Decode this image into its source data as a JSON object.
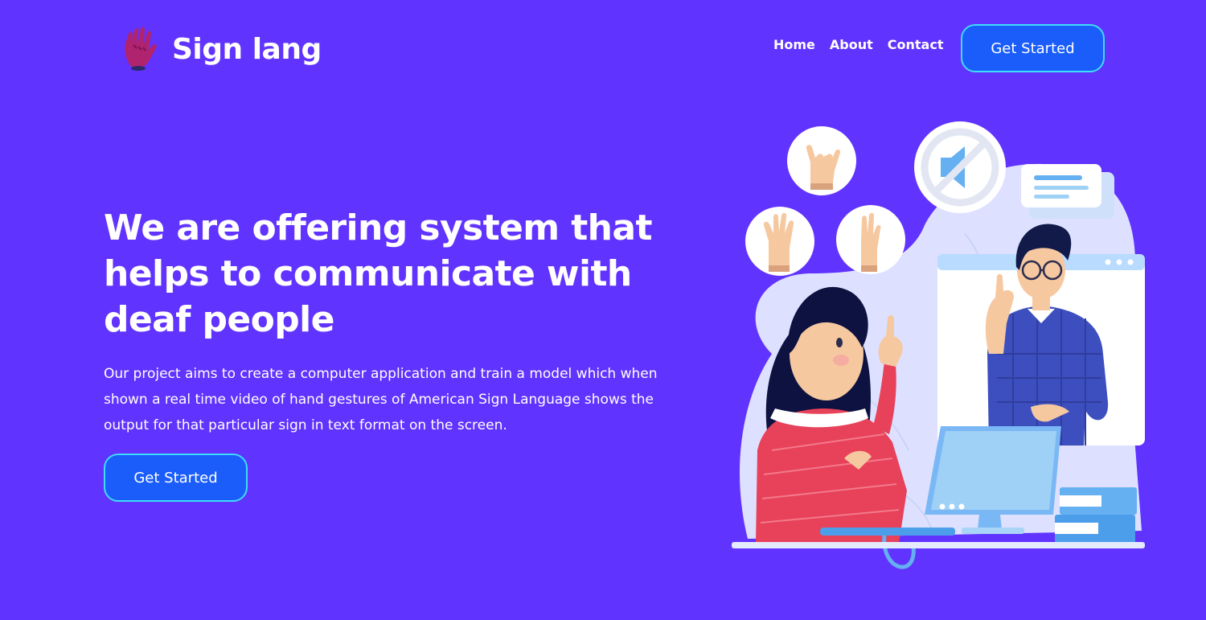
{
  "brand": {
    "name": "Sign lang",
    "logo_icon": "raised-hand-icon"
  },
  "nav": {
    "links": [
      "Home",
      "About",
      "Contact"
    ],
    "cta_label": "Get Started"
  },
  "hero": {
    "title": "We are offering system that helps to communicate with deaf people",
    "description": "Our project aims to create a computer application and train a model which when shown a real time video of hand gestures of American Sign Language shows the output for that particular sign in text format on the screen.",
    "cta_label": "Get Started"
  },
  "illustration": {
    "subject": "sign-language-video-call-illustration",
    "icons": [
      "hand-sign-icon",
      "hand-sign-icon",
      "hand-sign-icon",
      "muted-speaker-icon",
      "chat-bubble-icon"
    ]
  },
  "colors": {
    "background": "#6133ff",
    "button": "#1a5dfb",
    "button_border": "#3fdcf7",
    "text": "#ffffff"
  }
}
